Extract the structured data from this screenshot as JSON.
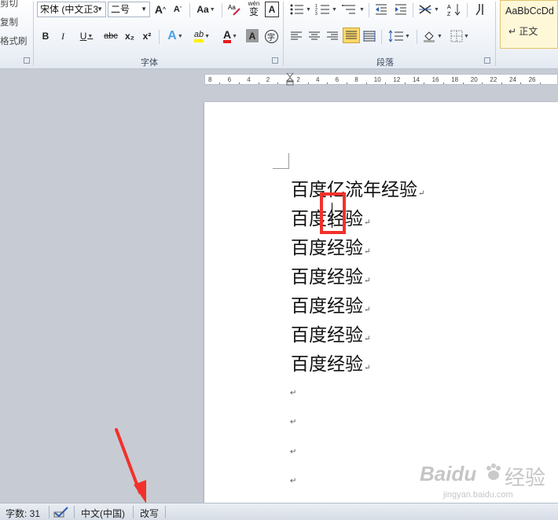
{
  "clipboard": {
    "items": [
      "剪切",
      "复制",
      "格式刷"
    ]
  },
  "font": {
    "name": "宋体 (中文正3",
    "size": "二号",
    "group_label": "字体",
    "grow_label": "A",
    "shrink_label": "A",
    "case_label": "Aa",
    "pinyin_label": "wén",
    "pinyin_char": "变",
    "border_char": "A",
    "bold": "B",
    "italic": "I",
    "underline": "U",
    "strike": "abc",
    "sub": "x₂",
    "sup": "x²",
    "effect": "A",
    "highlight": "ab",
    "color": "A",
    "shade": "A",
    "enclose": "字"
  },
  "paragraph": {
    "group_label": "段落"
  },
  "styles": {
    "sample": "AaBbCcDd",
    "name": "↵ 正文"
  },
  "ruler": {
    "ticks": [
      "8",
      "6",
      "4",
      "2",
      "2",
      "4",
      "6",
      "8",
      "10",
      "12",
      "14",
      "16",
      "18",
      "20",
      "22",
      "24",
      "26"
    ]
  },
  "document": {
    "lines": [
      "百度亿流年经验",
      "百度经验",
      "百度经验",
      "百度经验",
      "百度经验",
      "百度经验",
      "百度经验"
    ],
    "paragraph_mark": "↵"
  },
  "status": {
    "word_count": "字数: 31",
    "language": "中文(中国)",
    "mode": "改写"
  },
  "watermark": {
    "brand": "Baidu",
    "cn": "经验",
    "url": "jingyan.baidu.com"
  },
  "colors": {
    "highlight_box": "#f2312b",
    "ribbon_active": "#ffd869",
    "annotation_arrow": "#f2312b"
  }
}
